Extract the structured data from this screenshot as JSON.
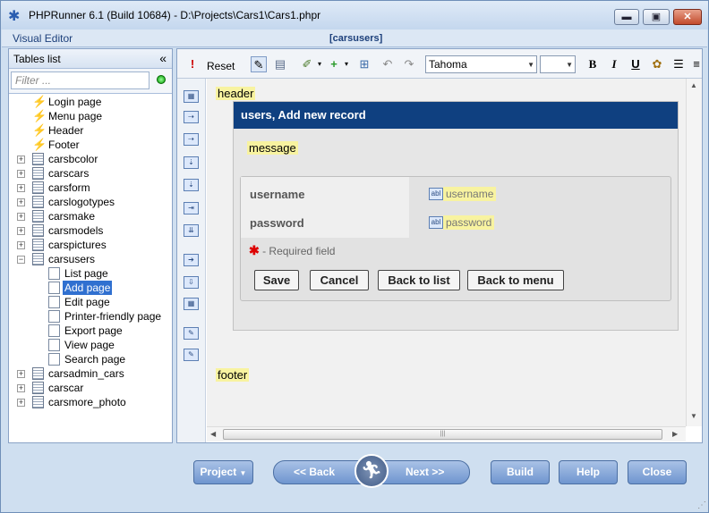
{
  "window": {
    "title": "PHPRunner 6.1 (Build 10684) - D:\\Projects\\Cars1\\Cars1.phpr",
    "app_icon": "runner-icon",
    "min_label": "▬",
    "max_label": "▣",
    "close_label": "✕"
  },
  "visual_editor_bar": {
    "label": "Visual Editor",
    "current_table": "[carsusers]"
  },
  "tables_panel": {
    "title": "Tables list",
    "collapse_label": "«",
    "filter_placeholder": "Filter ...",
    "items": [
      {
        "label": "Login page",
        "type": "page"
      },
      {
        "label": "Menu page",
        "type": "page"
      },
      {
        "label": "Header",
        "type": "page"
      },
      {
        "label": "Footer",
        "type": "page"
      },
      {
        "label": "carsbcolor",
        "type": "table"
      },
      {
        "label": "carscars",
        "type": "table"
      },
      {
        "label": "carsform",
        "type": "table"
      },
      {
        "label": "carslogotypes",
        "type": "table"
      },
      {
        "label": "carsmake",
        "type": "table"
      },
      {
        "label": "carsmodels",
        "type": "table"
      },
      {
        "label": "carspictures",
        "type": "table"
      },
      {
        "label": "carsusers",
        "type": "table-open"
      },
      {
        "label": "List page",
        "type": "child"
      },
      {
        "label": "Add page",
        "type": "child-selected"
      },
      {
        "label": "Edit page",
        "type": "child"
      },
      {
        "label": "Printer-friendly page",
        "type": "child"
      },
      {
        "label": "Export page",
        "type": "child"
      },
      {
        "label": "View page",
        "type": "child"
      },
      {
        "label": "Search page",
        "type": "child"
      },
      {
        "label": "carsadmin_cars",
        "type": "table"
      },
      {
        "label": "carscar",
        "type": "table"
      },
      {
        "label": "carsmore_photo",
        "type": "table"
      }
    ]
  },
  "toolbar": {
    "reset_label": "Reset",
    "font_name": "Tahoma",
    "font_size": "",
    "bold_label": "B",
    "italic_label": "I",
    "underline_label": "U"
  },
  "canvas": {
    "header_label": "header",
    "footer_label": "footer",
    "card_title": "users, Add new record",
    "message_label": "message",
    "fields": [
      {
        "label": "username",
        "value": "username"
      },
      {
        "label": "password",
        "value": "password"
      }
    ],
    "required_note": "- Required field",
    "buttons": [
      "Save",
      "Cancel",
      "Back to list",
      "Back to menu"
    ]
  },
  "bottom": {
    "project_label": "Project",
    "back_label": "<< Back",
    "next_label": "Next >>",
    "build_label": "Build",
    "help_label": "Help",
    "close_label": "Close"
  }
}
